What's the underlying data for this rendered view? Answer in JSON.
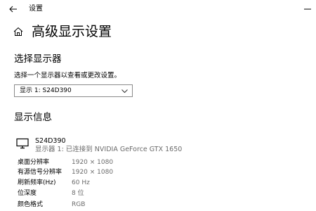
{
  "window": {
    "title": "设置"
  },
  "page": {
    "title": "高级显示设置"
  },
  "select_display": {
    "heading": "选择显示器",
    "description": "选择一个显示器以查看或更改设置。",
    "dropdown_value": "显示 1: S24D390"
  },
  "display_info": {
    "heading": "显示信息",
    "monitor_name": "S24D390",
    "monitor_connection": "显示器 1: 已连接到 NVIDIA GeForce GTX 1650",
    "rows": [
      {
        "label": "桌面分辨率",
        "value": "1920 × 1080"
      },
      {
        "label": "有源信号分辨率",
        "value": "1920 × 1080"
      },
      {
        "label": "刷新频率(Hz)",
        "value": "60 Hz"
      },
      {
        "label": "位深度",
        "value": "8 位"
      },
      {
        "label": "颜色格式",
        "value": "RGB"
      }
    ]
  },
  "icons": {
    "back": "back-arrow-icon",
    "minimize": "minimize-icon",
    "home": "home-icon",
    "chevron": "chevron-down-icon",
    "monitor": "monitor-icon"
  }
}
